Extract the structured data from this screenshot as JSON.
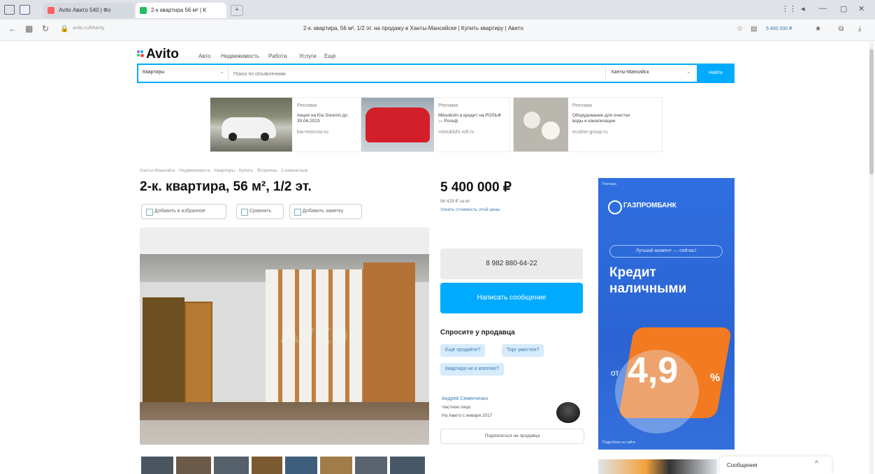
{
  "browser": {
    "tabs": [
      {
        "label": "Avito Авито 540 | Фо"
      },
      {
        "label": "2-к квартира 56 м² | К"
      }
    ],
    "page_title": "2-к. квартира, 56 м², 1/2 эт. на продажу в Ханты-Мансийске | Купить квартиру | Авито",
    "url": "avito.ru/khanty",
    "price_hint": "5 400 000 ₽",
    "colors": {
      "tabbar": "#dfe3e8",
      "accent": "#00aaff"
    }
  },
  "header": {
    "logo": "Avito",
    "nav": [
      "Авто",
      "Недвижимость",
      "Работа",
      "Услуги",
      "Ещё"
    ],
    "search": {
      "category": "Квартиры",
      "placeholder": "Поиск по объявлениям",
      "location": "Ханты-Мансийск",
      "button": "Найти"
    }
  },
  "ads": [
    {
      "title": "Kia Sorento",
      "label": "Реклама",
      "line": "Акция на Kia Sorento до 30.06.2023",
      "source": "kia-moscow.ru"
    },
    {
      "title": "Mitsubishi",
      "label": "Реклама",
      "line": "Mitsubishi в кредит на РОЛЬФ — Рольф",
      "source": "mitsubishi-rolf.ru"
    },
    {
      "title": "Оборудование",
      "label": "Реклама",
      "line": "Оборудование для очистки воды и канализации",
      "source": "ecoline-group.ru"
    }
  ],
  "listing": {
    "breadcrumb": "Ханты-Мансийск · Недвижимость · Квартиры · Купить · Вторичка · 2-комнатные",
    "title": "2-к. квартира, 56 м², 1/2 эт.",
    "actions": [
      "Добавить в избранное",
      "Сравнить",
      "Добавить заметку"
    ],
    "price": "5 400 000 ₽",
    "price_per_m2": "96 429 ₽ за м²",
    "price_link": "Узнать стоимость этой цены",
    "phone": "8 982 880-64-22",
    "message_button": "Написать сообщение",
    "ask_title": "Спросите у продавца",
    "questions": [
      "Ещё продаёте?",
      "Торг уместен?",
      "Квартира не в ипотеке?"
    ],
    "seller": {
      "name": "Андрей Семенченко",
      "type": "Частное лицо",
      "since": "На Авито с января 2017",
      "subscribe": "Подписаться на продавца"
    },
    "watermark": "Avito"
  },
  "banner": {
    "label": "Реклама",
    "brand": "ГАЗПРОМБАНК",
    "slogan": "Лучший момент — сейчас!",
    "headline": "Кредит наличными",
    "rate_prefix": "от",
    "rate": "4,9",
    "rate_unit": "%",
    "disclaimer": "Подробнее на сайте"
  },
  "messages_panel": {
    "label": "Сообщения"
  }
}
